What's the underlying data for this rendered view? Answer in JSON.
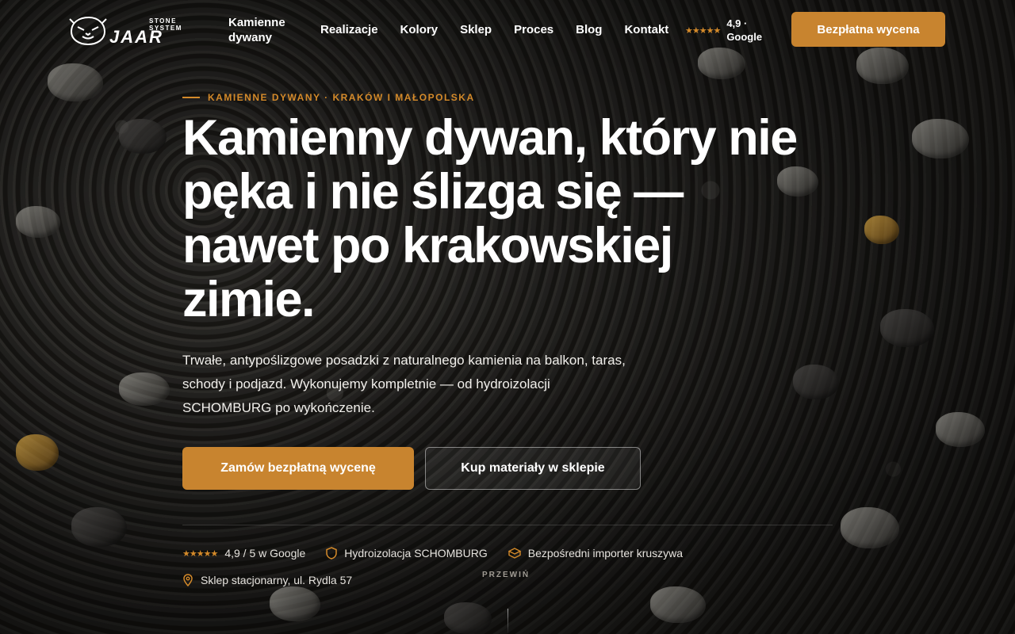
{
  "brand": {
    "subtitle": "STONE SYSTEM",
    "name": "JAAR",
    "tagline": "Kamienne dywany"
  },
  "nav": {
    "items": [
      "Realizacje",
      "Kolory",
      "Sklep",
      "Proces",
      "Blog",
      "Kontakt"
    ]
  },
  "rating": {
    "stars": "★★★★★",
    "text": "4,9 · Google"
  },
  "header_cta": "Bezpłatna wycena",
  "hero": {
    "eyebrow": "KAMIENNE DYWANY · KRAKÓW I MAŁOPOLSKA",
    "title": "Kamienny dywan, który nie pęka i nie ślizga się — nawet po krakowskiej zimie.",
    "lead": "Trwałe, antypoślizgowe posadzki z naturalnego kamienia na balkon, taras, schody i podjazd. Wykonujemy kompletnie — od hydroizolacji SCHOMBURG po wykończenie.",
    "primary_button": "Zamów bezpłatną wycenę",
    "secondary_button": "Kup materiały w sklepie"
  },
  "trust": {
    "stars": "★★★★★",
    "rating": "4,9 / 5 w Google",
    "hydro": "Hydroizolacja SCHOMBURG",
    "importer": "Bezpośredni importer kruszywa",
    "store": "Sklep stacjonarny, ul. Rydla 57"
  },
  "scroll_hint": "PRZEWIŃ",
  "colors": {
    "accent": "#c8842f",
    "accent_text": "#d48a2a"
  },
  "icons": [
    "tiger-logo-icon",
    "star-icon",
    "shield-icon",
    "box-icon",
    "map-pin-icon"
  ]
}
